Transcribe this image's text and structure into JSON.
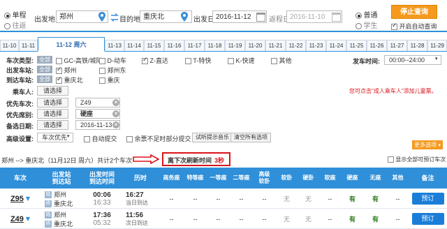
{
  "topbar": {
    "trip_types": [
      "单程",
      "往返"
    ],
    "from_label": "出发地",
    "from_value": "郑州",
    "to_label": "目的地",
    "to_value": "重庆北",
    "depart_label": "出发日",
    "depart_value": "2016-11-12",
    "return_label": "返程日",
    "return_value": "2016-11-10",
    "passenger_types": [
      "普通",
      "学生"
    ],
    "query_button": "停止查询",
    "auto_query_label": "开启自动查询"
  },
  "date_tabs": [
    "11-10",
    "11-11",
    "11-12 周六",
    "11-13",
    "11-14",
    "11-15",
    "11-16",
    "11-17",
    "11-18",
    "11-19",
    "11-20",
    "11-21",
    "11-22",
    "11-23",
    "11-24",
    "11-25",
    "11-26",
    "11-27",
    "11-28",
    "11-29"
  ],
  "filters": {
    "train_type_label": "车次类型:",
    "all_tag": "全部",
    "train_types": [
      "GC-高铁/城际",
      "D-动车",
      "Z-直达",
      "T-特快",
      "K-快速",
      "其他"
    ],
    "depart_time_label": "发车时间:",
    "depart_time_value": "00:00--24:00",
    "from_station_label": "出发车站:",
    "from_stations": [
      "郑州",
      "郑州东"
    ],
    "to_station_label": "到达车站:",
    "to_stations": [
      "重庆北",
      "重庆"
    ],
    "passenger_label": "乘车人:",
    "choose": "请选择",
    "child_tip": "您可点击\"成人乘车人\"添加儿童票。",
    "priority_train_label": "优先车次:",
    "priority_train_value": "Z49",
    "priority_seat_label": "优先席别:",
    "priority_seat_value": "硬座",
    "backup_date_label": "备选日期:",
    "backup_date_value": "2016-11-13",
    "advanced_label": "高级设置:",
    "advanced_value": "车次优先",
    "auto_submit": "自动提交",
    "partial_submit": "余票不足时部分提交",
    "test_music": "试听提示音乐",
    "clear_all": "清空所有选项",
    "more_options": "更多选项"
  },
  "summary": {
    "route_text": "郑州 --> 重庆北（11月12日 周六）共计2个车次",
    "refresh_label": "离下次刷新时间",
    "refresh_seconds": "3秒",
    "show_all_label": "显示全部可预订车次"
  },
  "table": {
    "headers": [
      "车次",
      "出发站\n到达站",
      "出发时间\n到达时间",
      "历时",
      "商务座",
      "特等座",
      "一等座",
      "二等座",
      "高级\n软卧",
      "软卧",
      "硬卧",
      "软座",
      "硬座",
      "无座",
      "其他",
      "备注"
    ],
    "rows": [
      {
        "train": "Z95",
        "from": "郑州",
        "to": "重庆北",
        "dep": "00:06",
        "arr": "16:33",
        "duration": "16:27",
        "arrive_day": "当日到达",
        "seats": [
          "--",
          "--",
          "--",
          "--",
          "--",
          "无",
          "无",
          "--",
          "有",
          "有",
          "--"
        ],
        "book": "预订"
      },
      {
        "train": "Z49",
        "from": "郑州",
        "to": "重庆北",
        "dep": "17:36",
        "arr": "05:32",
        "duration": "11:56",
        "arrive_day": "次日到达",
        "seats": [
          "--",
          "--",
          "--",
          "--",
          "--",
          "无",
          "无",
          "--",
          "有",
          "有",
          "--"
        ],
        "book": "预订"
      }
    ]
  },
  "colors": {
    "accent_blue": "#2f8fd8",
    "orange": "#f59a1f",
    "red_arrow": "#d9141b",
    "available_green": "#2a7a1a"
  }
}
